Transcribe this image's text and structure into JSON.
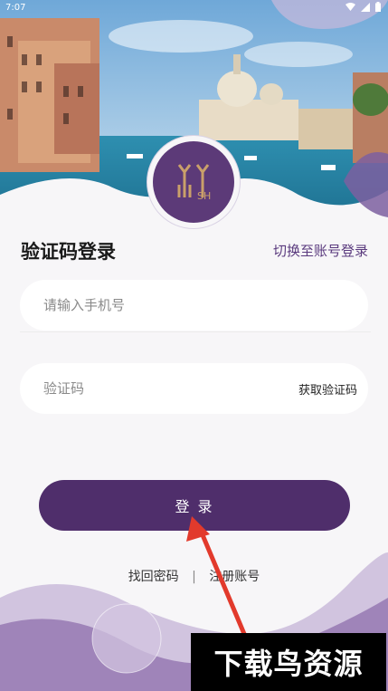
{
  "status": {
    "time": "7:07"
  },
  "logo": {
    "text": "SH"
  },
  "login": {
    "title": "验证码登录",
    "switch_label": "切换至账号登录",
    "phone_placeholder": "请输入手机号",
    "code_placeholder": "验证码",
    "get_code_label": "获取验证码",
    "login_button": "登 录"
  },
  "links": {
    "forgot": "找回密码",
    "separator": "|",
    "register": "注册账号"
  },
  "watermark": {
    "text": "下载鸟资源"
  },
  "colors": {
    "primary": "#4f2e6b",
    "accent": "#5a3a7e",
    "background": "#f7f6f8",
    "arrow": "#e23a2c"
  }
}
